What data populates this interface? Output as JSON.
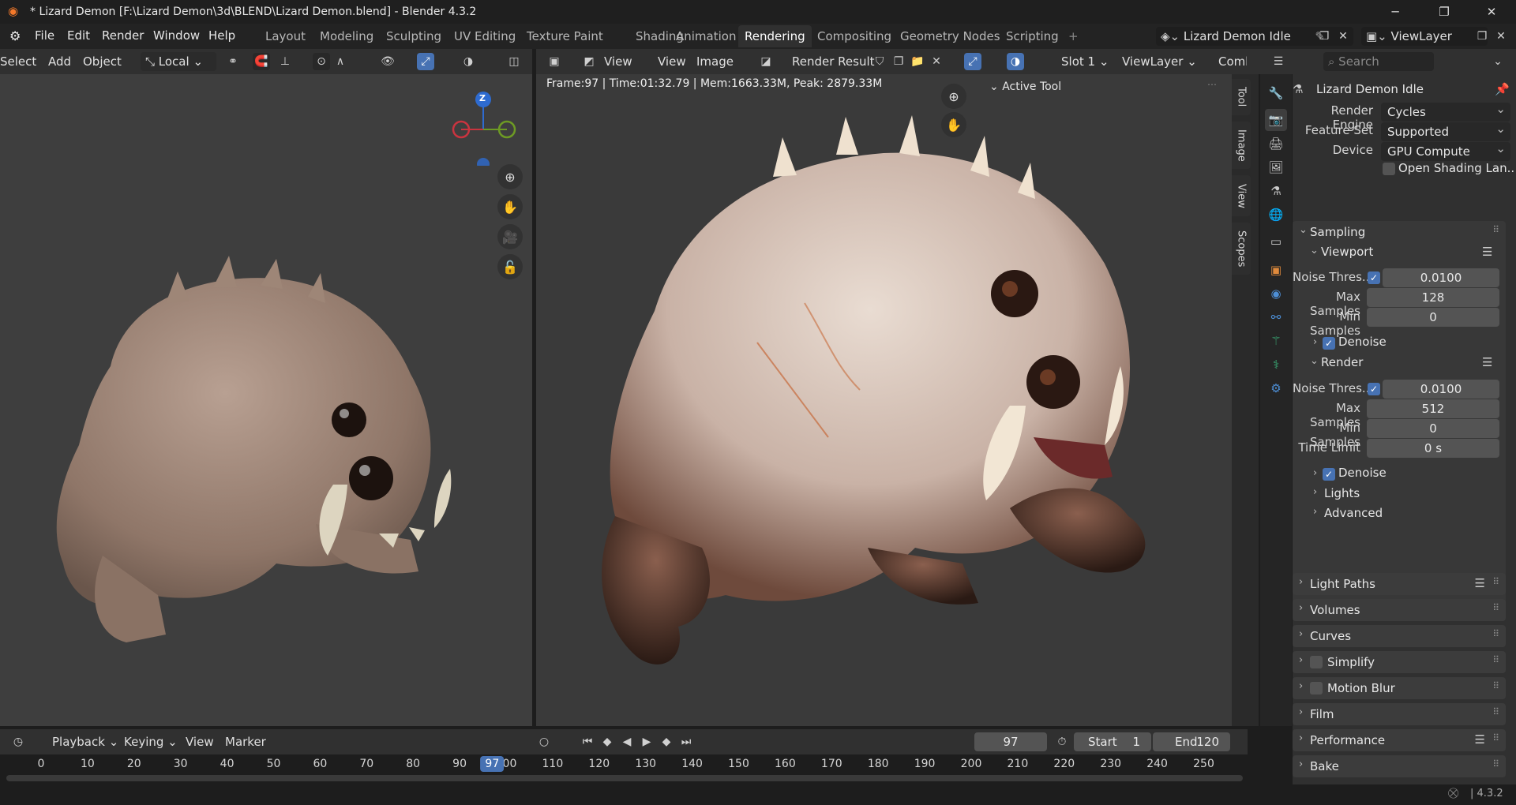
{
  "window": {
    "title": "* Lizard Demon [F:\\Lizard Demon\\3d\\BLEND\\Lizard Demon.blend] - Blender 4.3.2",
    "minimize": "─",
    "maximize": "❐",
    "close": "✕"
  },
  "menu": [
    "File",
    "Edit",
    "Render",
    "Window",
    "Help"
  ],
  "workspaces": [
    "Layout",
    "Modeling",
    "Sculpting",
    "UV Editing",
    "Texture Paint",
    "Shading",
    "Animation",
    "Rendering",
    "Compositing",
    "Geometry Nodes",
    "Scripting"
  ],
  "workspace_add": "+",
  "active_workspace": "Rendering",
  "scene": {
    "name": "Lizard Demon Idle",
    "view_layer": "ViewLayer"
  },
  "viewport_left": {
    "header": [
      "Select",
      "Add",
      "Object"
    ],
    "orientation": "Local",
    "gizmo_axis": {
      "z": "Z"
    }
  },
  "image_editor": {
    "menus": [
      "View",
      "View",
      "Image"
    ],
    "image_name": "Render Result",
    "slot": "Slot 1",
    "layer": "ViewLayer",
    "pass": "Combi",
    "info": "Frame:97 | Time:01:32.79 | Mem:1663.33M, Peak: 2879.33M",
    "active_tool": "Active Tool",
    "side_tabs": [
      "Tool",
      "Image",
      "View",
      "Scopes"
    ]
  },
  "properties": {
    "search_placeholder": "Search",
    "scene_name": "Lizard Demon Idle",
    "render_engine_label": "Render Engine",
    "render_engine": "Cycles",
    "feature_set_label": "Feature Set",
    "feature_set": "Supported",
    "device_label": "Device",
    "device": "GPU Compute",
    "osl_label": "Open Shading Lan...",
    "sampling": "Sampling",
    "viewport": "Viewport",
    "vp_noise_label": "Noise Thres...",
    "vp_noise": "0.0100",
    "vp_max_label": "Max Samples",
    "vp_max": "128",
    "vp_min_label": "Min Samples",
    "vp_min": "0",
    "denoise": "Denoise",
    "render": "Render",
    "r_noise_label": "Noise Thres...",
    "r_noise": "0.0100",
    "r_max_label": "Max Samples",
    "r_max": "512",
    "r_min_label": "Min Samples",
    "r_min": "0",
    "r_time_label": "Time Limit",
    "r_time": "0 s",
    "r_denoise": "Denoise",
    "lights": "Lights",
    "advanced": "Advanced",
    "panels": [
      "Light Paths",
      "Volumes",
      "Curves",
      "Simplify",
      "Motion Blur",
      "Film",
      "Performance",
      "Bake"
    ]
  },
  "timeline": {
    "menus": [
      "Playback",
      "Keying",
      "View",
      "Marker"
    ],
    "current_frame": "97",
    "start_label": "Start",
    "start": "1",
    "end_label": "End",
    "end": "120",
    "ticks": [
      "0",
      "10",
      "20",
      "30",
      "40",
      "50",
      "60",
      "70",
      "80",
      "90",
      "100",
      "110",
      "120",
      "130",
      "140",
      "150",
      "160",
      "170",
      "180",
      "190",
      "200",
      "210",
      "220",
      "230",
      "240",
      "250"
    ],
    "playhead": "97"
  },
  "status": {
    "version": "4.3.2"
  },
  "colors": {
    "accent": "#4772b3",
    "axis_x": "#c9343f",
    "axis_y": "#6d9a24",
    "axis_z": "#2e6bd0"
  }
}
